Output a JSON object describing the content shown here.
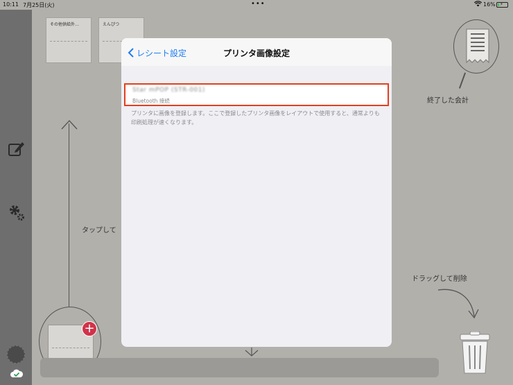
{
  "status_bar": {
    "time": "10:11",
    "date": "7月25日(火)",
    "dots": "•••",
    "battery_percent": "16%",
    "battery_level": 16
  },
  "tiles": [
    {
      "label": "その他供給外…"
    },
    {
      "label": "えんぴつ"
    }
  ],
  "hints": {
    "tap": "タップして",
    "finished": "終了した会計",
    "drag_delete": "ドラッグして削除"
  },
  "modal": {
    "back_label": "レシート設定",
    "title": "プリンタ画像設定",
    "printer": {
      "name": "Star mPOP (STR-001)",
      "connection": "Bluetooth 接続"
    },
    "footnote": "プリンタに画像を登録します。ここで登録したプリンタ画像をレイアウトで使用すると、通常よりも印刷処理が速くなります。"
  },
  "colors": {
    "accent": "#1f7cf2",
    "highlight": "#e2401f",
    "badge": "#d0334a",
    "battery_fill": "#36c24a"
  },
  "icons": [
    "wifi-icon",
    "battery-icon",
    "compose-icon",
    "gear-icon",
    "cloud-check-icon",
    "receipt-icon",
    "trash-icon",
    "plus-icon",
    "chevron-left-icon"
  ]
}
